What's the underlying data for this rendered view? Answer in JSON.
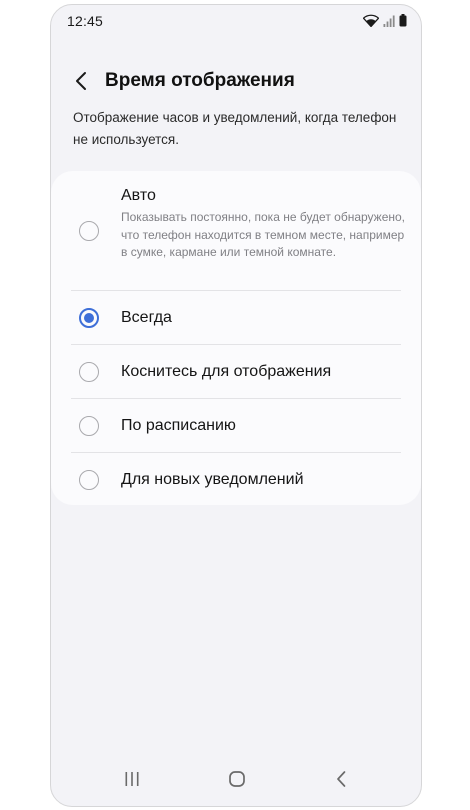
{
  "status_bar": {
    "time": "12:45",
    "icons": [
      "wifi-icon",
      "signal-icon",
      "battery-icon"
    ]
  },
  "header": {
    "back_icon": "chevron-left-icon",
    "title": "Время отображения"
  },
  "description": "Отображение часов и уведомлений, когда телефон не используется.",
  "options": [
    {
      "label": "Авто",
      "sublabel": "Показывать постоянно, пока не будет обнаружено, что телефон находится в темном месте, например в сумке, кармане или темной комнате.",
      "selected": false
    },
    {
      "label": "Всегда",
      "selected": true
    },
    {
      "label": "Коснитесь для отображения",
      "selected": false
    },
    {
      "label": "По расписанию",
      "selected": false
    },
    {
      "label": "Для новых уведомлений",
      "selected": false
    }
  ],
  "colors": {
    "accent": "#3e6fd8",
    "background": "#f3f3f7",
    "card": "#fbfbfd"
  },
  "nav_bar": {
    "icons": [
      "recent-apps-icon",
      "home-icon",
      "back-nav-icon"
    ]
  }
}
